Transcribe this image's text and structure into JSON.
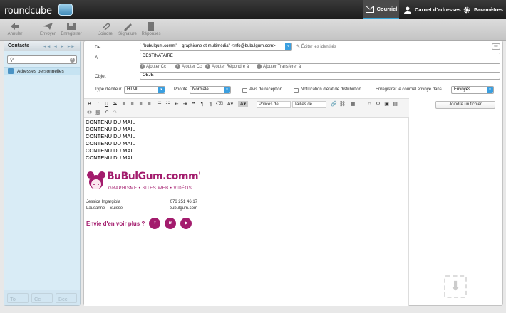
{
  "app": {
    "logo": "roundcube"
  },
  "topnav": {
    "mail": "Courriel",
    "contacts": "Carnet d'adresses",
    "settings": "Paramètres"
  },
  "toolbar": {
    "cancel": "Annuler",
    "send": "Envoyer",
    "save": "Enregistrer",
    "attach": "Joindre",
    "signature": "Signature",
    "responses": "Réponses"
  },
  "sidebar": {
    "title": "Contacts",
    "addressbook": "Adresses personnelles",
    "search_placeholder": "",
    "recipient_buttons": [
      "To",
      "Cc",
      "Bcc"
    ]
  },
  "compose": {
    "from_label": "De",
    "from_value": "\"bubulgum.comm\" – graphisme et multimédia\" <info@bubulgum.com>",
    "edit_identities": "Éditer les identités",
    "to_label": "À",
    "to_value": "DESTINATAIRE",
    "add_cc": "Ajouter Cc",
    "add_bcc": "Ajouter Cci",
    "add_replyto": "Ajouter Répondre à",
    "add_followupto": "Ajouter Transférer à",
    "subject_label": "Objet",
    "subject_value": "OBJET",
    "editor_type_label": "Type d'éditeur",
    "editor_type_value": "HTML",
    "priority_label": "Priorité",
    "priority_value": "Normale",
    "receipt_label": "Avis de réception",
    "dsn_label": "Notification d'état de distribution",
    "save_sent_label": "Enregistrer le courriel envoyé dans",
    "save_sent_value": "Envoyés",
    "attach_button": "Joindre un fichier",
    "font_dropdown": "Polices de...",
    "size_dropdown": "Tailles de l..."
  },
  "body": {
    "lines": [
      "CONTENU DU MAIL",
      "CONTENU DU MAIL",
      "CONTENU DU MAIL",
      "CONTENU DU MAIL",
      "CONTENU DU MAIL",
      "CONTENU DU MAIL"
    ]
  },
  "signature": {
    "brand": "BuBulGum.comm'",
    "tagline": "GRAPHISME • SITES WEB • VIDÉOS",
    "name": "Jessica Ingargiola",
    "phone": "076 251 46 17",
    "city": "Lausanne – Suisse",
    "web": "bubulgum.com",
    "cta": "Envie d'en voir plus ?",
    "social": [
      "f",
      "in",
      "▶"
    ]
  },
  "colors": {
    "brand": "#a31c6d",
    "accent": "#37a5d8"
  }
}
